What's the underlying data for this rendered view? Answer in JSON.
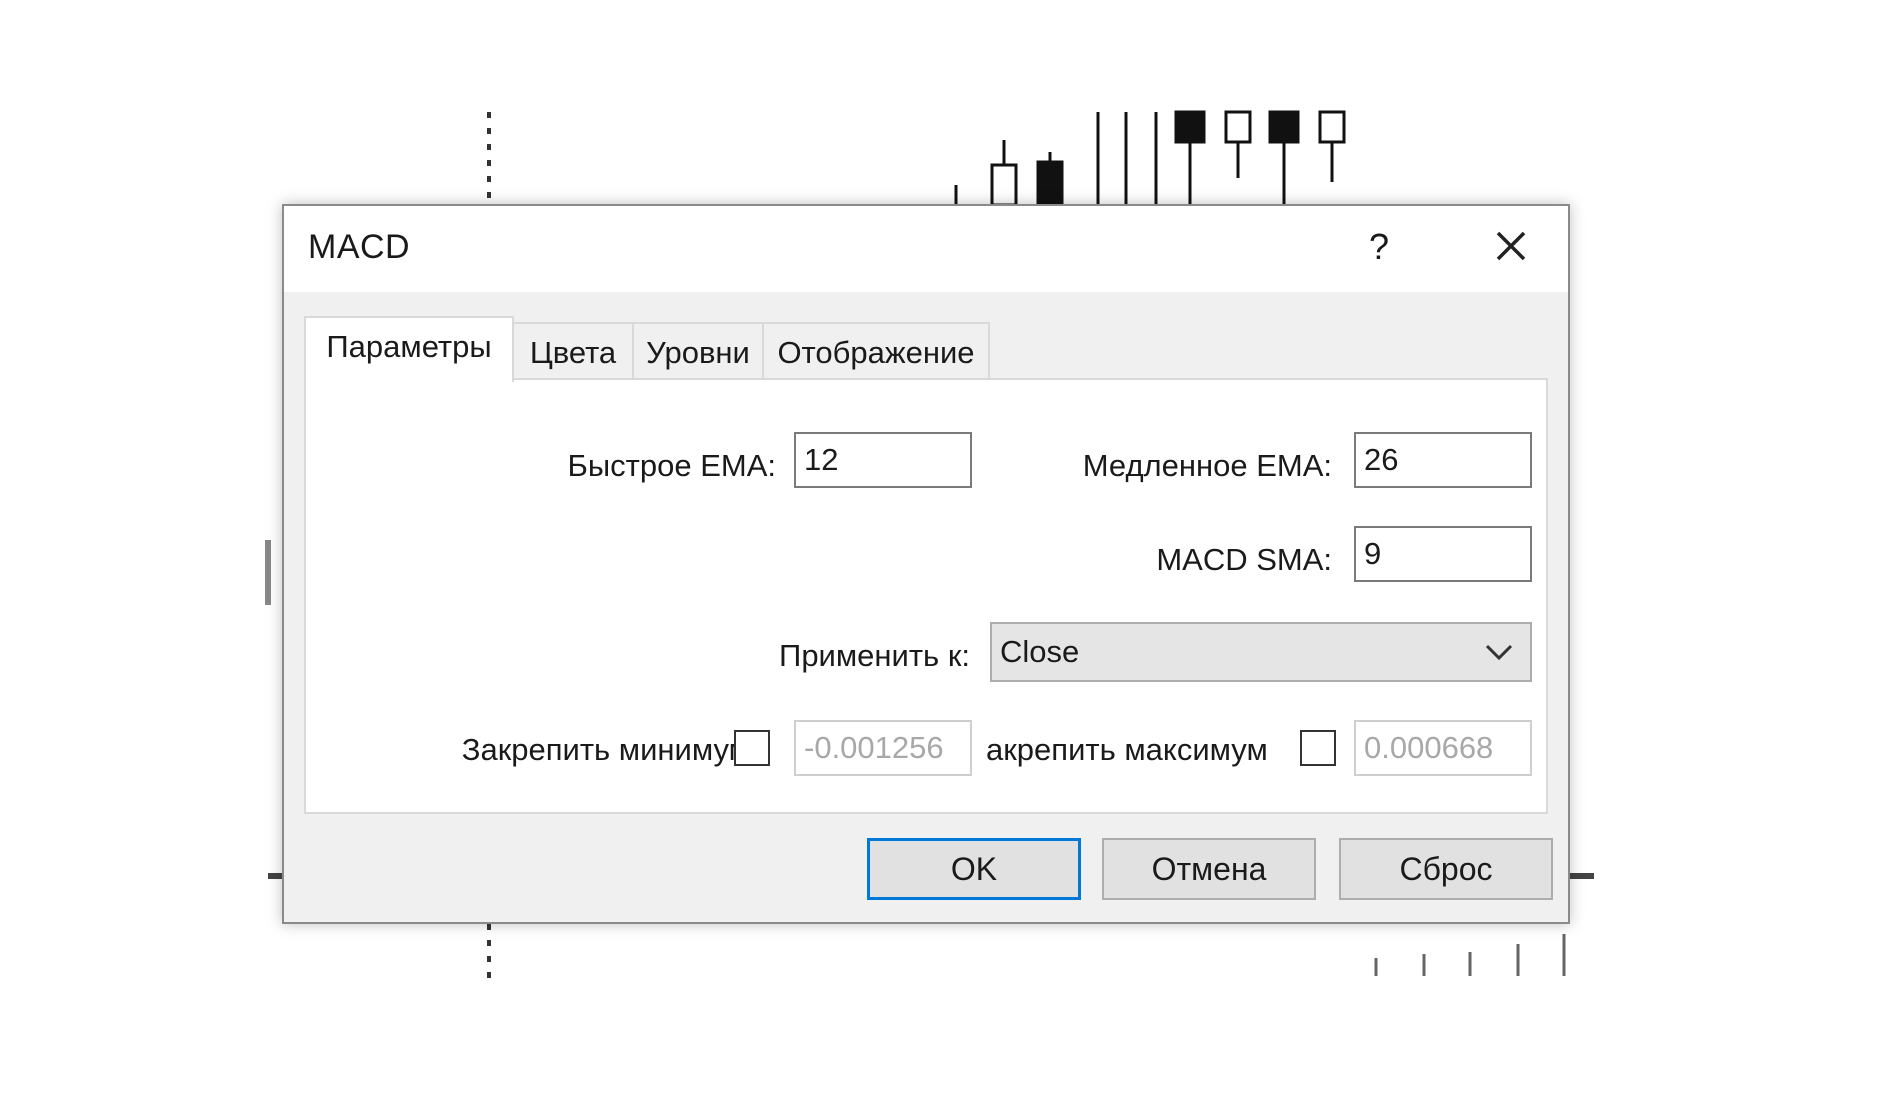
{
  "dialog": {
    "title": "MACD",
    "help_label": "?",
    "tabs": [
      {
        "label": "Параметры",
        "active": true
      },
      {
        "label": "Цвета",
        "active": false
      },
      {
        "label": "Уровни",
        "active": false
      },
      {
        "label": "Отображение",
        "active": false
      }
    ],
    "params": {
      "fast_ema_label": "Быстрое EMA:",
      "fast_ema_value": "12",
      "slow_ema_label": "Медленное EMA:",
      "slow_ema_value": "26",
      "macd_sma_label": "MACD SMA:",
      "macd_sma_value": "9",
      "apply_to_label": "Применить к:",
      "apply_to_value": "Close",
      "fix_min_label": "Закрепить минимум",
      "fix_min_value": "-0.001256",
      "fix_min_checked": false,
      "fix_max_label": "акрепить максимум",
      "fix_max_value": "0.000668",
      "fix_max_checked": false
    },
    "buttons": {
      "ok": "OK",
      "cancel": "Отмена",
      "reset": "Сброс"
    }
  },
  "icons": {
    "help": "question-icon",
    "close": "close-icon",
    "dropdown": "chevron-down-icon"
  },
  "colors": {
    "accent": "#0078d7",
    "dialog_bg": "#f0f0f0",
    "panel_bg": "#ffffff"
  }
}
